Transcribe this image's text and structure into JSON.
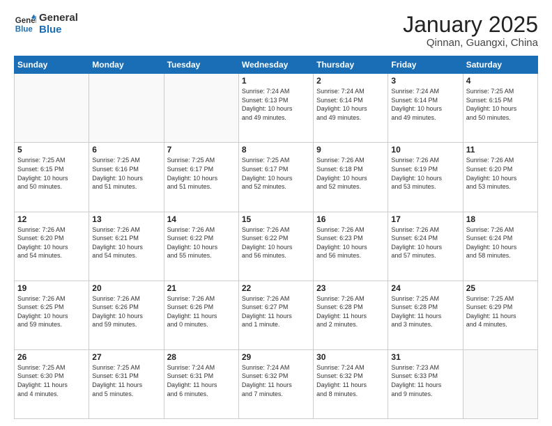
{
  "header": {
    "logo_general": "General",
    "logo_blue": "Blue",
    "month_title": "January 2025",
    "location": "Qinnan, Guangxi, China"
  },
  "weekdays": [
    "Sunday",
    "Monday",
    "Tuesday",
    "Wednesday",
    "Thursday",
    "Friday",
    "Saturday"
  ],
  "weeks": [
    [
      {
        "day": "",
        "info": ""
      },
      {
        "day": "",
        "info": ""
      },
      {
        "day": "",
        "info": ""
      },
      {
        "day": "1",
        "info": "Sunrise: 7:24 AM\nSunset: 6:13 PM\nDaylight: 10 hours\nand 49 minutes."
      },
      {
        "day": "2",
        "info": "Sunrise: 7:24 AM\nSunset: 6:14 PM\nDaylight: 10 hours\nand 49 minutes."
      },
      {
        "day": "3",
        "info": "Sunrise: 7:24 AM\nSunset: 6:14 PM\nDaylight: 10 hours\nand 49 minutes."
      },
      {
        "day": "4",
        "info": "Sunrise: 7:25 AM\nSunset: 6:15 PM\nDaylight: 10 hours\nand 50 minutes."
      }
    ],
    [
      {
        "day": "5",
        "info": "Sunrise: 7:25 AM\nSunset: 6:15 PM\nDaylight: 10 hours\nand 50 minutes."
      },
      {
        "day": "6",
        "info": "Sunrise: 7:25 AM\nSunset: 6:16 PM\nDaylight: 10 hours\nand 51 minutes."
      },
      {
        "day": "7",
        "info": "Sunrise: 7:25 AM\nSunset: 6:17 PM\nDaylight: 10 hours\nand 51 minutes."
      },
      {
        "day": "8",
        "info": "Sunrise: 7:25 AM\nSunset: 6:17 PM\nDaylight: 10 hours\nand 52 minutes."
      },
      {
        "day": "9",
        "info": "Sunrise: 7:26 AM\nSunset: 6:18 PM\nDaylight: 10 hours\nand 52 minutes."
      },
      {
        "day": "10",
        "info": "Sunrise: 7:26 AM\nSunset: 6:19 PM\nDaylight: 10 hours\nand 53 minutes."
      },
      {
        "day": "11",
        "info": "Sunrise: 7:26 AM\nSunset: 6:20 PM\nDaylight: 10 hours\nand 53 minutes."
      }
    ],
    [
      {
        "day": "12",
        "info": "Sunrise: 7:26 AM\nSunset: 6:20 PM\nDaylight: 10 hours\nand 54 minutes."
      },
      {
        "day": "13",
        "info": "Sunrise: 7:26 AM\nSunset: 6:21 PM\nDaylight: 10 hours\nand 54 minutes."
      },
      {
        "day": "14",
        "info": "Sunrise: 7:26 AM\nSunset: 6:22 PM\nDaylight: 10 hours\nand 55 minutes."
      },
      {
        "day": "15",
        "info": "Sunrise: 7:26 AM\nSunset: 6:22 PM\nDaylight: 10 hours\nand 56 minutes."
      },
      {
        "day": "16",
        "info": "Sunrise: 7:26 AM\nSunset: 6:23 PM\nDaylight: 10 hours\nand 56 minutes."
      },
      {
        "day": "17",
        "info": "Sunrise: 7:26 AM\nSunset: 6:24 PM\nDaylight: 10 hours\nand 57 minutes."
      },
      {
        "day": "18",
        "info": "Sunrise: 7:26 AM\nSunset: 6:24 PM\nDaylight: 10 hours\nand 58 minutes."
      }
    ],
    [
      {
        "day": "19",
        "info": "Sunrise: 7:26 AM\nSunset: 6:25 PM\nDaylight: 10 hours\nand 59 minutes."
      },
      {
        "day": "20",
        "info": "Sunrise: 7:26 AM\nSunset: 6:26 PM\nDaylight: 10 hours\nand 59 minutes."
      },
      {
        "day": "21",
        "info": "Sunrise: 7:26 AM\nSunset: 6:26 PM\nDaylight: 11 hours\nand 0 minutes."
      },
      {
        "day": "22",
        "info": "Sunrise: 7:26 AM\nSunset: 6:27 PM\nDaylight: 11 hours\nand 1 minute."
      },
      {
        "day": "23",
        "info": "Sunrise: 7:26 AM\nSunset: 6:28 PM\nDaylight: 11 hours\nand 2 minutes."
      },
      {
        "day": "24",
        "info": "Sunrise: 7:25 AM\nSunset: 6:28 PM\nDaylight: 11 hours\nand 3 minutes."
      },
      {
        "day": "25",
        "info": "Sunrise: 7:25 AM\nSunset: 6:29 PM\nDaylight: 11 hours\nand 4 minutes."
      }
    ],
    [
      {
        "day": "26",
        "info": "Sunrise: 7:25 AM\nSunset: 6:30 PM\nDaylight: 11 hours\nand 4 minutes."
      },
      {
        "day": "27",
        "info": "Sunrise: 7:25 AM\nSunset: 6:31 PM\nDaylight: 11 hours\nand 5 minutes."
      },
      {
        "day": "28",
        "info": "Sunrise: 7:24 AM\nSunset: 6:31 PM\nDaylight: 11 hours\nand 6 minutes."
      },
      {
        "day": "29",
        "info": "Sunrise: 7:24 AM\nSunset: 6:32 PM\nDaylight: 11 hours\nand 7 minutes."
      },
      {
        "day": "30",
        "info": "Sunrise: 7:24 AM\nSunset: 6:32 PM\nDaylight: 11 hours\nand 8 minutes."
      },
      {
        "day": "31",
        "info": "Sunrise: 7:23 AM\nSunset: 6:33 PM\nDaylight: 11 hours\nand 9 minutes."
      },
      {
        "day": "",
        "info": ""
      }
    ]
  ]
}
